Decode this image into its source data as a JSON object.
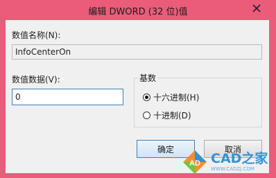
{
  "dialog": {
    "title": "编辑 DWORD (32 位)值",
    "close_glyph": "✕"
  },
  "value_name": {
    "label": "数值名称(N):",
    "value": "InfoCenterOn"
  },
  "value_data": {
    "label": "数值数据(V):",
    "value": "0"
  },
  "base": {
    "title": "基数",
    "options": [
      {
        "label": "十六进制(H)",
        "selected": true
      },
      {
        "label": "十进制(D)",
        "selected": false
      }
    ]
  },
  "buttons": {
    "ok": "确定",
    "cancel": "取消"
  },
  "watermark": {
    "brand": "CAD之家",
    "url": "WWW.CADZJ.COM",
    "badge": "AD"
  },
  "colors": {
    "title_bar": "#ea5c7a",
    "focus_border": "#3c7fb1"
  }
}
